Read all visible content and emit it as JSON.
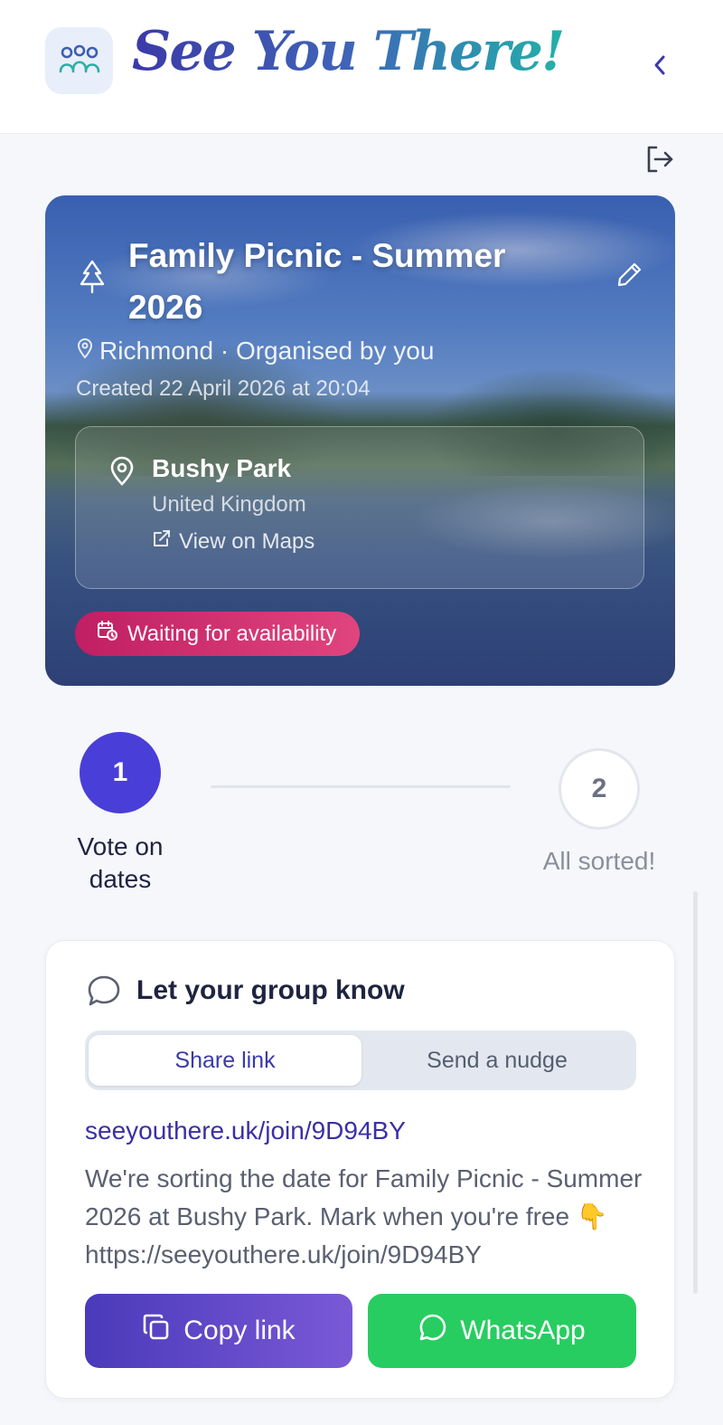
{
  "app": {
    "title": "See You There!"
  },
  "event": {
    "title": "Family Picnic - Summer 2026",
    "subtitle": "Richmond · Organised by you",
    "created": "Created 22 April 2026 at 20:04",
    "venue": {
      "name": "Bushy Park",
      "country": "United Kingdom",
      "maps_label": "View on Maps"
    },
    "status": "Waiting for availability"
  },
  "stepper": {
    "steps": [
      {
        "number": "1",
        "label": "Vote on dates"
      },
      {
        "number": "2",
        "label": "All sorted!"
      }
    ]
  },
  "share": {
    "heading": "Let your group know",
    "tabs": [
      "Share link",
      "Send a nudge"
    ],
    "link": "seeyouthere.uk/join/9D94BY",
    "message": "We're sorting the date for Family Picnic - Summer 2026 at Bushy Park. Mark when you're free 👇 https://seeyouthere.uk/join/9D94BY",
    "copy_label": "Copy link",
    "whatsapp_label": "WhatsApp"
  },
  "colors": {
    "accent": "#4a3ed8",
    "status": "#c01f63",
    "whatsapp": "#27cd60"
  },
  "icons": [
    "people-icon",
    "chevron-left-icon",
    "logout-icon",
    "tree-icon",
    "edit-icon",
    "location-pin-icon",
    "external-link-icon",
    "calendar-clock-icon",
    "chat-bubble-icon",
    "copy-icon",
    "whatsapp-icon"
  ]
}
